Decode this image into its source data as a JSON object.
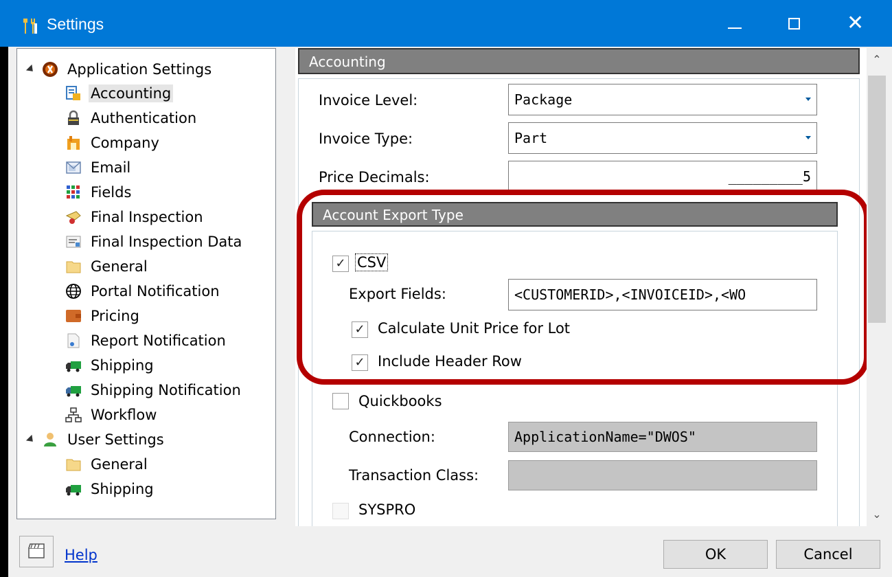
{
  "window": {
    "title": "Settings",
    "minimize_icon": "minimize-icon",
    "maximize_icon": "maximize-icon",
    "close_glyph": "✕"
  },
  "tree": {
    "groups": [
      {
        "label": "Application Settings",
        "icon": "application-settings-icon",
        "expanded": true
      },
      {
        "label": "User Settings",
        "icon": "user-settings-icon",
        "expanded": true
      }
    ],
    "app_items": [
      {
        "label": "Accounting",
        "icon": "accounting-icon",
        "selected": true
      },
      {
        "label": "Authentication",
        "icon": "lock-icon"
      },
      {
        "label": "Company",
        "icon": "company-icon"
      },
      {
        "label": "Email",
        "icon": "email-icon"
      },
      {
        "label": "Fields",
        "icon": "fields-grid-icon"
      },
      {
        "label": "Final Inspection",
        "icon": "final-inspection-icon"
      },
      {
        "label": "Final Inspection Data",
        "icon": "inspection-data-icon"
      },
      {
        "label": "General",
        "icon": "folder-icon"
      },
      {
        "label": "Portal Notification",
        "icon": "globe-icon"
      },
      {
        "label": "Pricing",
        "icon": "pricing-icon"
      },
      {
        "label": "Report Notification",
        "icon": "report-icon"
      },
      {
        "label": "Shipping",
        "icon": "truck-icon"
      },
      {
        "label": "Shipping Notification",
        "icon": "shipping-notification-icon"
      },
      {
        "label": "Workflow",
        "icon": "workflow-icon"
      }
    ],
    "user_items": [
      {
        "label": "General",
        "icon": "folder-icon"
      },
      {
        "label": "Shipping",
        "icon": "truck-icon"
      }
    ]
  },
  "accounting": {
    "header": "Accounting",
    "invoice_level_label": "Invoice Level:",
    "invoice_level_value": "Package",
    "invoice_type_label": "Invoice Type:",
    "invoice_type_value": "Part",
    "price_decimals_label": "Price Decimals:",
    "price_decimals_value": "_________5"
  },
  "export": {
    "header": "Account Export Type",
    "csv_label": "CSV",
    "csv_checked": true,
    "export_fields_label": "Export Fields:",
    "export_fields_value": "<CUSTOMERID>,<INVOICEID>,<WO",
    "calc_unit_price_label": "Calculate Unit Price for Lot",
    "calc_unit_price_checked": true,
    "include_header_label": "Include Header Row",
    "include_header_checked": true,
    "quickbooks_label": "Quickbooks",
    "quickbooks_checked": false,
    "connection_label": "Connection:",
    "connection_value": "ApplicationName=\"DWOS\"",
    "transaction_class_label": "Transaction Class:",
    "transaction_class_value": "",
    "syspro_label": "SYSPRO",
    "syspro_checked": false
  },
  "footer": {
    "help_label": "Help",
    "ok_label": "OK",
    "cancel_label": "Cancel"
  },
  "colors": {
    "titlebar": "#0078d7",
    "highlight_ring": "#b40000",
    "section_header": "#808080"
  }
}
